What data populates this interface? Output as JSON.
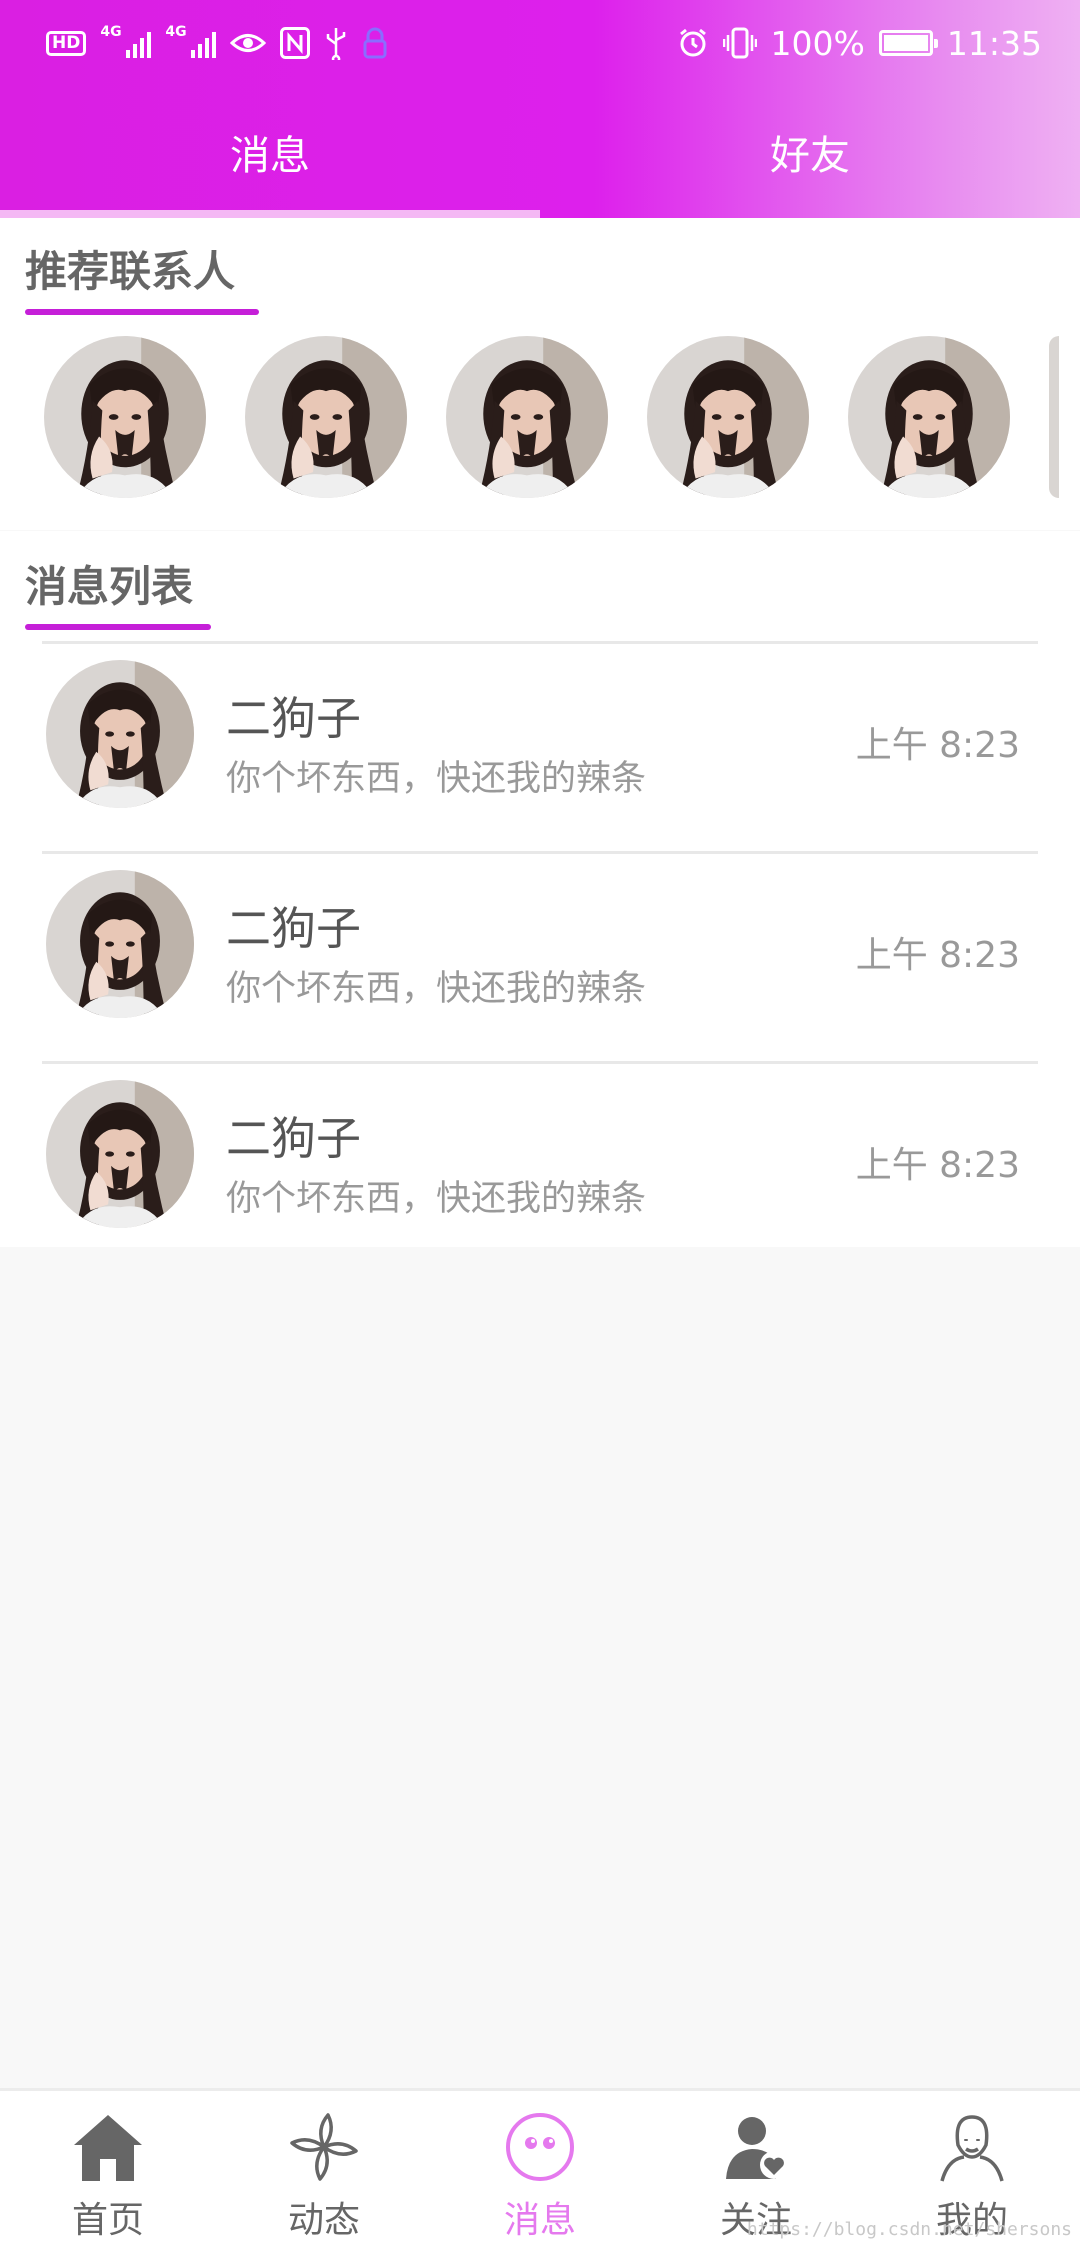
{
  "status_bar": {
    "left_icons": [
      "hd-icon",
      "signal-4g-1-icon",
      "signal-4g-2-icon",
      "eye-icon",
      "nfc-icon",
      "usb-icon",
      "lock-icon"
    ],
    "signal_tag_1": "4G",
    "signal_tag_2": "4G",
    "hd_label": "HD",
    "right_icons": [
      "alarm-icon",
      "vibrate-icon",
      "battery-icon"
    ],
    "battery": "100%",
    "time": "11:35"
  },
  "tabs": [
    {
      "label": "消息",
      "active": true
    },
    {
      "label": "好友",
      "active": false
    }
  ],
  "recommend": {
    "title": "推荐联系人",
    "avatar_count": 6
  },
  "messages": {
    "title": "消息列表",
    "items": [
      {
        "name": "二狗子",
        "text": "你个坏东西，快还我的辣条",
        "time": "上午  8:23"
      },
      {
        "name": "二狗子",
        "text": "你个坏东西，快还我的辣条",
        "time": "上午  8:23"
      },
      {
        "name": "二狗子",
        "text": "你个坏东西，快还我的辣条",
        "time": "上午  8:23"
      }
    ]
  },
  "bottom_nav": [
    {
      "label": "首页",
      "icon": "home-icon",
      "active": false
    },
    {
      "label": "动态",
      "icon": "pinwheel-icon",
      "active": false
    },
    {
      "label": "消息",
      "icon": "message-face-icon",
      "active": true
    },
    {
      "label": "关注",
      "icon": "follow-heart-icon",
      "active": false
    },
    {
      "label": "我的",
      "icon": "profile-icon",
      "active": false
    }
  ],
  "watermark": "https://blog.csdn.net/shersons",
  "colors": {
    "header_gradient_start": "#da1fe2",
    "header_gradient_end": "#efb1f3",
    "section_underline": "#c51fd8",
    "active_nav": "#e579ee"
  }
}
